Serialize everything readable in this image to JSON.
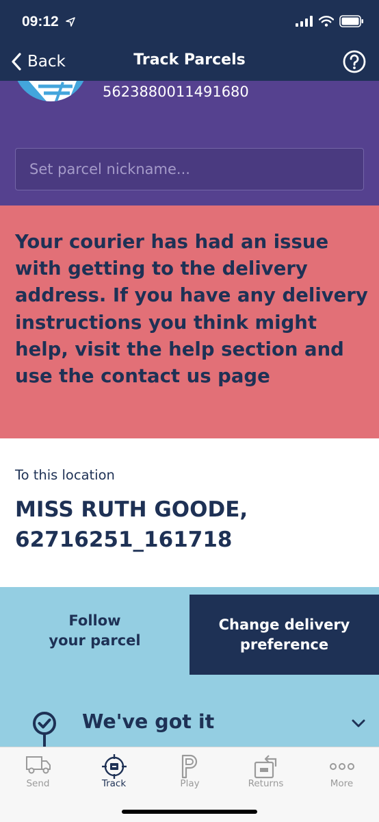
{
  "status_bar": {
    "time": "09:12"
  },
  "nav": {
    "back_label": "Back",
    "title": "Track Parcels"
  },
  "parcel": {
    "tracking_number": "5623880011491680",
    "nickname_placeholder": "Set parcel nickname..."
  },
  "alert": {
    "message": "Your courier has had an issue with getting to the delivery address. If you have any delivery instructions you think might help, visit the help section and use the contact us page"
  },
  "location": {
    "label": "To this location",
    "name": "MISS RUTH GOODE, 62716251_161718"
  },
  "tabs": {
    "follow_line1": "Follow",
    "follow_line2": "your parcel",
    "change_line1": "Change delivery",
    "change_line2": "preference"
  },
  "timeline": {
    "status": "We've got it"
  },
  "tab_bar": {
    "items": [
      {
        "label": "Send",
        "icon": "van-icon",
        "active": false
      },
      {
        "label": "Track",
        "icon": "track-target-icon",
        "active": true
      },
      {
        "label": "Play",
        "icon": "play-p-icon",
        "active": false
      },
      {
        "label": "Returns",
        "icon": "returns-box-icon",
        "active": false
      },
      {
        "label": "More",
        "icon": "more-dots-icon",
        "active": false
      }
    ]
  },
  "colors": {
    "navy": "#1e3155",
    "purple": "#55418f",
    "alert_red": "#e27077",
    "light_blue": "#94cee2",
    "logo_blue": "#43a5dc"
  }
}
